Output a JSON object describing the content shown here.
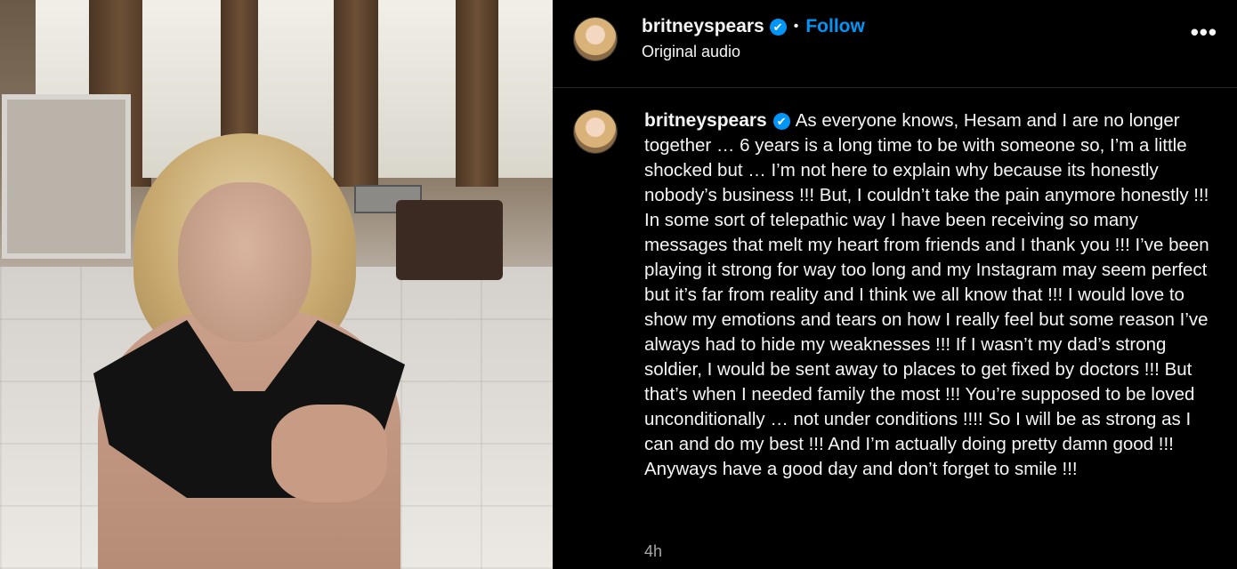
{
  "header": {
    "username": "britneyspears",
    "verified_icon": "✔",
    "separator": "•",
    "follow_label": "Follow",
    "audio_label": "Original audio",
    "more_label": "•••"
  },
  "comment": {
    "username": "britneyspears",
    "verified_icon": "✔",
    "caption": "As everyone knows, Hesam and I are no longer together … 6 years is a long time to be with someone so, I’m a little shocked but … I’m not here to explain why because its honestly nobody’s business !!! But, I couldn’t take the pain anymore honestly !!! In some sort of telepathic way I have been receiving so many messages that melt my heart from friends and I thank you !!! I’ve been playing it strong for way too long and my Instagram may seem perfect but it’s far from reality and I think we all know that !!! I would love to show my emotions and tears on how I really feel but some reason I’ve always had to hide my weaknesses !!! If I wasn’t my dad’s strong soldier, I would be sent away to places to get fixed by doctors !!! But that’s when I needed family the most !!! You’re supposed to be loved unconditionally … not under conditions !!!! So I will be as strong as I can and do my best !!! And I’m actually doing pretty damn good !!! Anyways have a good day and don’t forget to smile !!!",
    "time": "4h"
  },
  "colors": {
    "background": "#000000",
    "accent": "#0095f6",
    "text": "#f5f5f5",
    "muted": "#a8a8a8"
  }
}
